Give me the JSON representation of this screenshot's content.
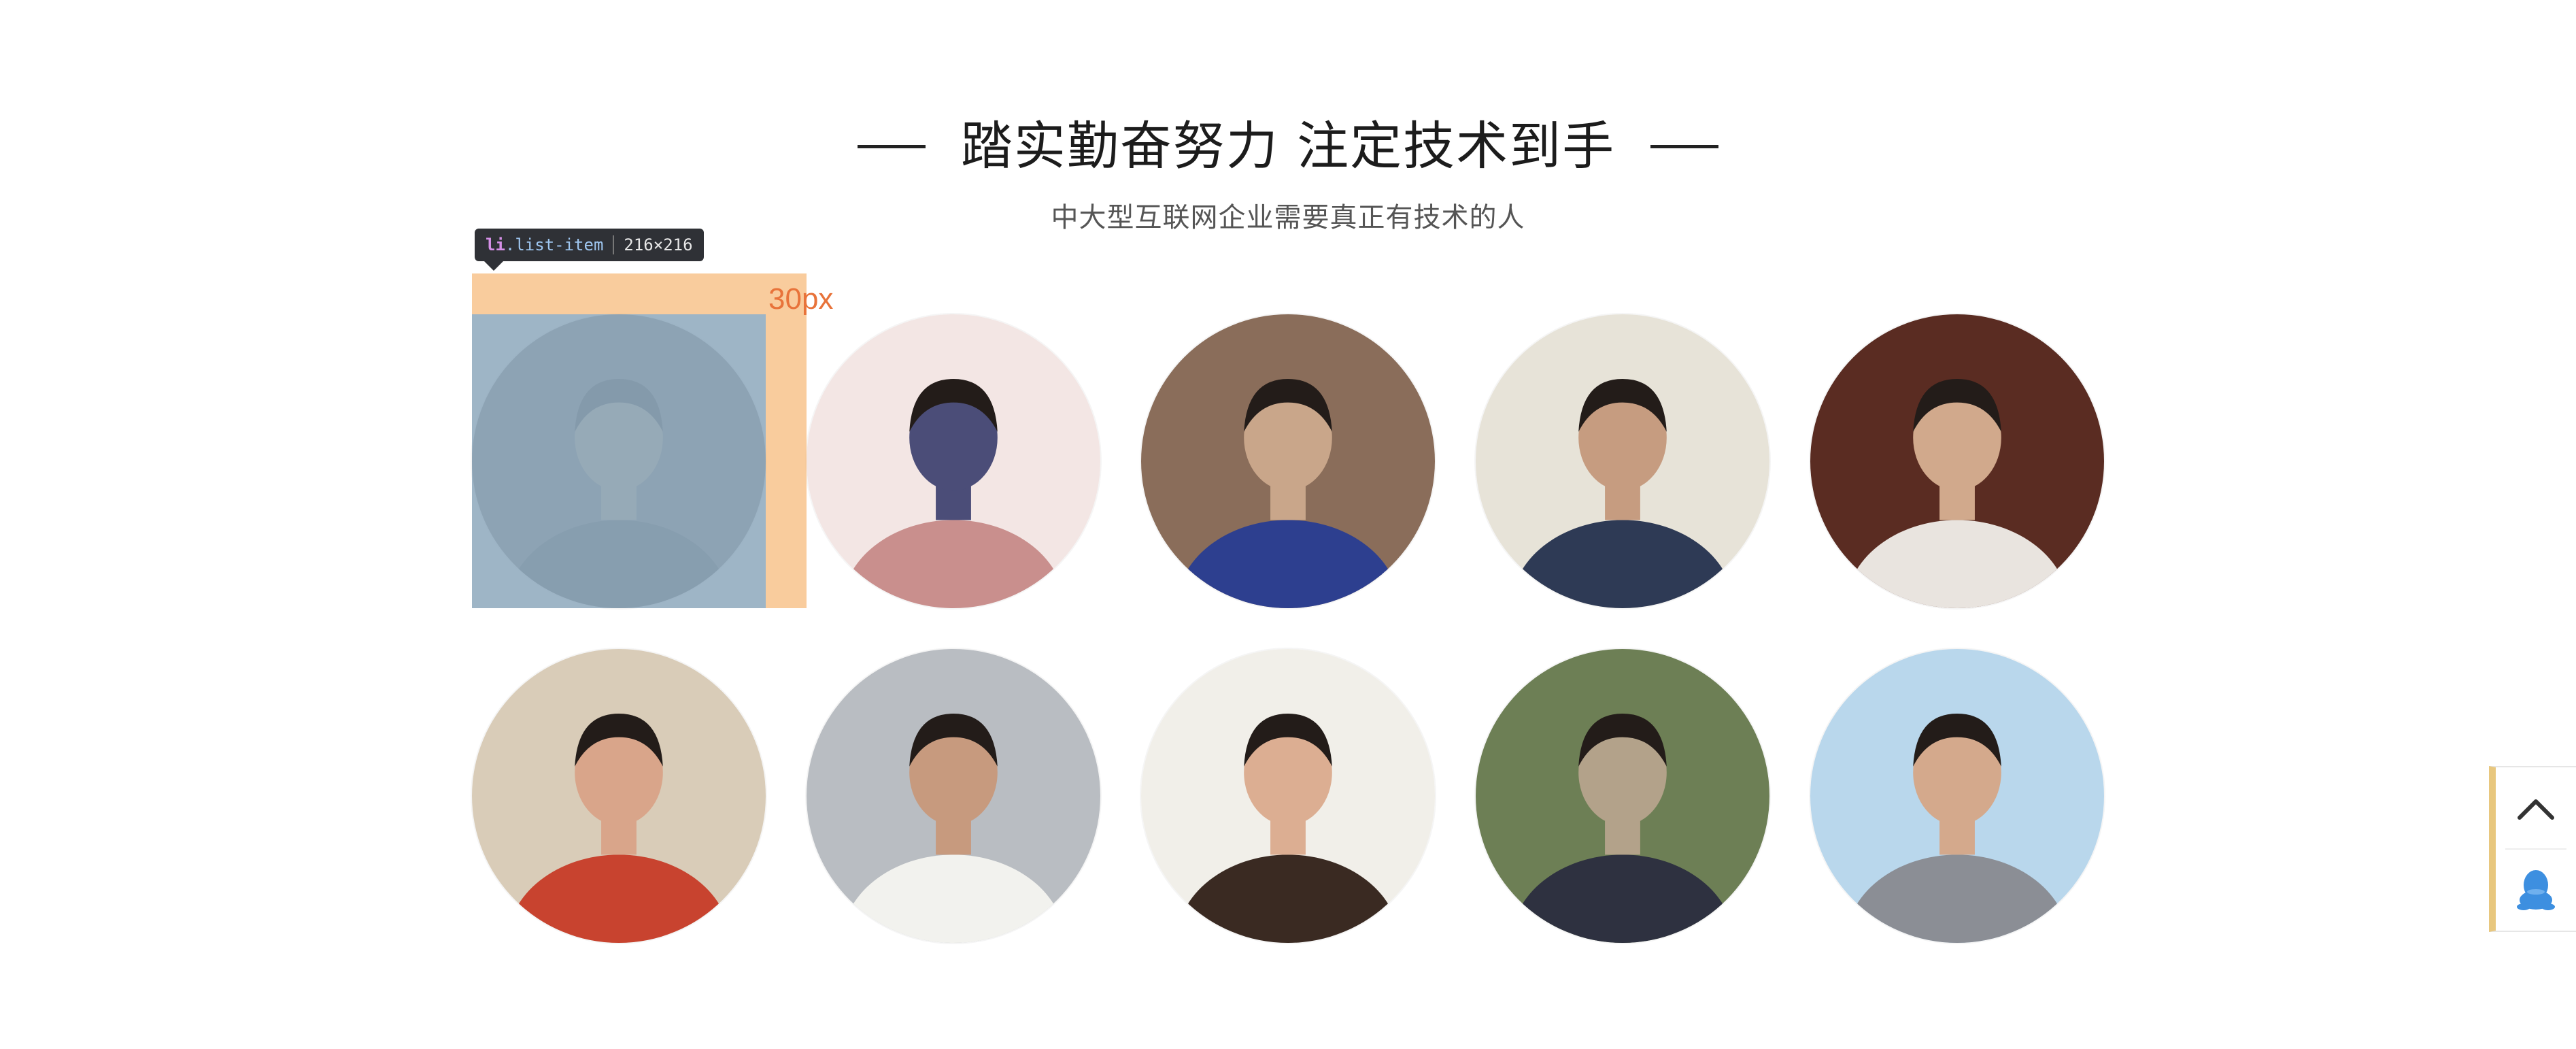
{
  "section": {
    "title": "踏实勤奋努力 注定技术到手",
    "subtitle": "中大型互联网企业需要真正有技术的人"
  },
  "avatars": [
    {
      "name": "student-1",
      "palette": [
        "#6f6a62",
        "#3f3b37",
        "#b9a27e"
      ]
    },
    {
      "name": "student-2",
      "palette": [
        "#f3e6e4",
        "#c98f8d",
        "#4b4d78"
      ]
    },
    {
      "name": "student-3",
      "palette": [
        "#8a6d5a",
        "#2d3f8f",
        "#c9a68a"
      ]
    },
    {
      "name": "student-4",
      "palette": [
        "#e7e3d8",
        "#2e3a55",
        "#c69c80"
      ]
    },
    {
      "name": "student-5",
      "palette": [
        "#5a2c22",
        "#e9e4df",
        "#d1a98c"
      ]
    },
    {
      "name": "student-6",
      "palette": [
        "#d9ccb8",
        "#c8432f",
        "#d9a58a"
      ]
    },
    {
      "name": "student-7",
      "palette": [
        "#b9bdc2",
        "#f2f2ee",
        "#c79a7e"
      ]
    },
    {
      "name": "student-8",
      "palette": [
        "#f1efe9",
        "#3a2a22",
        "#dcae92"
      ]
    },
    {
      "name": "student-9",
      "palette": [
        "#6d7f55",
        "#2e3140",
        "#b3a28a"
      ]
    },
    {
      "name": "student-10",
      "palette": [
        "#b9d7ec",
        "#8b8e95",
        "#d4a98c"
      ]
    }
  ],
  "devtools": {
    "selector_tag": "li",
    "selector_class": ".list-item",
    "size": "216×216",
    "margin_label": "30px",
    "colors": {
      "margin_overlay": "#f6b26b",
      "content_overlay": "#6fa8dc",
      "label": "#e8733a"
    }
  },
  "toolbar": {
    "back_to_top_icon": "chevron-up-icon",
    "qq_icon": "qq-penguin-icon",
    "accent": "#e8c77e",
    "qq_color": "#3d8fe0"
  }
}
